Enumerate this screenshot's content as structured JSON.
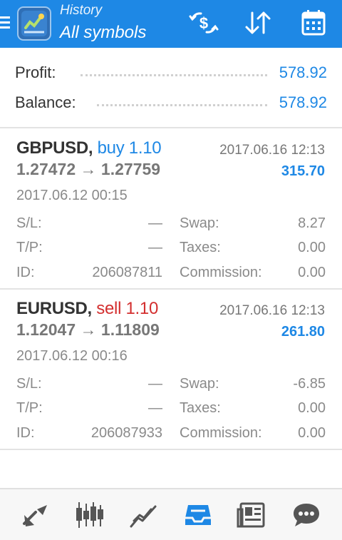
{
  "header": {
    "title_small": "History",
    "title_big": "All symbols",
    "icons": [
      "currency-exchange-icon",
      "sort-icon",
      "calendar-icon"
    ]
  },
  "summary": {
    "profit_label": "Profit:",
    "profit_value": "578.92",
    "balance_label": "Balance:",
    "balance_value": "578.92"
  },
  "deals": [
    {
      "symbol": "GBPUSD,",
      "side": "buy 1.10",
      "side_type": "buy",
      "close_time": "2017.06.16 12:13",
      "price_open": "1.27472",
      "arrow": "→",
      "price_close": "1.27759",
      "profit": "315.70",
      "open_time": "2017.06.12 00:15",
      "sl_label": "S/L:",
      "sl_value": "—",
      "tp_label": "T/P:",
      "tp_value": "—",
      "id_label": "ID:",
      "id_value": "206087811",
      "swap_label": "Swap:",
      "swap_value": "8.27",
      "taxes_label": "Taxes:",
      "taxes_value": "0.00",
      "commission_label": "Commission:",
      "commission_value": "0.00"
    },
    {
      "symbol": "EURUSD,",
      "side": "sell 1.10",
      "side_type": "sell",
      "close_time": "2017.06.16 12:13",
      "price_open": "1.12047",
      "arrow": "→",
      "price_close": "1.11809",
      "profit": "261.80",
      "open_time": "2017.06.12 00:16",
      "sl_label": "S/L:",
      "sl_value": "—",
      "tp_label": "T/P:",
      "tp_value": "—",
      "id_label": "ID:",
      "id_value": "206087933",
      "swap_label": "Swap:",
      "swap_value": "-6.85",
      "taxes_label": "Taxes:",
      "taxes_value": "0.00",
      "commission_label": "Commission:",
      "commission_value": "0.00"
    }
  ],
  "bottom_nav": [
    "quotes-icon",
    "chart-candles-icon",
    "trade-icon",
    "history-icon",
    "news-icon",
    "chat-icon"
  ],
  "colors": {
    "accent": "#1E88E5",
    "sell": "#D32F2F",
    "active_nav": "#1E88E5",
    "inactive_nav": "#555555"
  }
}
